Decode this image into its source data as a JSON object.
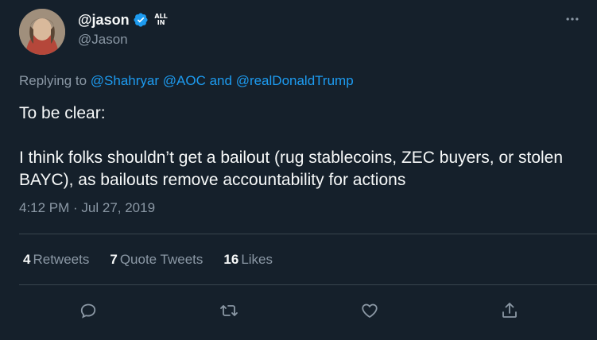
{
  "user": {
    "display_name": "@jason",
    "handle": "@Jason",
    "verified": true,
    "affiliation_badge": {
      "line1": "ALL",
      "line2": "IN"
    }
  },
  "reply": {
    "prefix": "Replying to ",
    "mentions": [
      "@Shahryar",
      "@AOC",
      "@realDonaldTrump"
    ],
    "conjunction": " and "
  },
  "tweet": {
    "line1": "To be clear:",
    "line2": "I think folks shouldn’t get a bailout (rug stablecoins, ZEC buyers, or stolen BAYC), as bailouts remove accountability for actions"
  },
  "timestamp": "4:12 PM · Jul 27, 2019",
  "stats": {
    "retweets": {
      "count": "4",
      "label": "Retweets"
    },
    "quote_tweets": {
      "count": "7",
      "label": "Quote Tweets"
    },
    "likes": {
      "count": "16",
      "label": "Likes"
    }
  },
  "actions": [
    "reply-icon",
    "retweet-icon",
    "like-icon",
    "share-icon"
  ],
  "colors": {
    "background": "#15202b",
    "text": "#f7f9f9",
    "secondary": "#8b98a5",
    "accent": "#1d9bf0",
    "divider": "#38444d"
  }
}
